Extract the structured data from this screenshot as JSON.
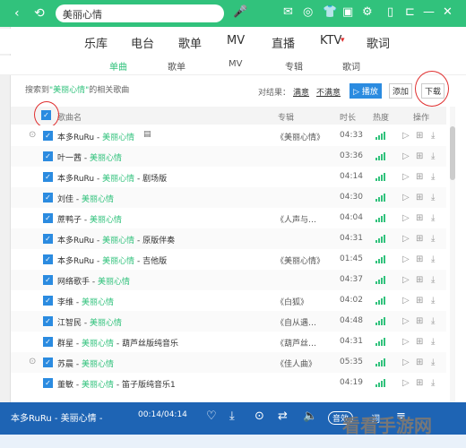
{
  "topbar": {
    "search_value": "美丽心情",
    "nav_back": "‹",
    "nav_refresh": "⟲"
  },
  "main_tabs": [
    "乐库",
    "电台",
    "歌单",
    "MV",
    "直播",
    "KTV",
    "歌词"
  ],
  "kt_badge": "▾",
  "sub_tabs": [
    "单曲",
    "歌单",
    "MV",
    "专辑",
    "歌词"
  ],
  "search_info": {
    "prefix": "搜索到",
    "keyword": "\"美丽心情\"",
    "suffix": "的相关歌曲"
  },
  "filter": {
    "label": "对结果：",
    "satisfied": "满意",
    "unsatisfied": "不满意"
  },
  "buttons": {
    "play": "▷ 播放",
    "add": "添加",
    "download": "下载"
  },
  "table_header": {
    "song": "歌曲名",
    "album": "专辑",
    "duration": "时长",
    "heat": "热度",
    "ops": "操作"
  },
  "rows": [
    {
      "artist": "本多RuRu",
      "sep": " - ",
      "title": "美丽心情",
      "extra": "",
      "album": "《美丽心情》",
      "duration": "04:33",
      "expand": true,
      "mv": true
    },
    {
      "artist": "叶一茜",
      "sep": " - ",
      "title": "美丽心情",
      "extra": "",
      "album": "",
      "duration": "03:36",
      "expand": false,
      "mv": false
    },
    {
      "artist": "本多RuRu",
      "sep": " - ",
      "title": "美丽心情",
      "extra": " - 剧场版",
      "album": "",
      "duration": "04:14",
      "expand": false,
      "mv": false
    },
    {
      "artist": "刘佳",
      "sep": " - ",
      "title": "美丽心情",
      "extra": "",
      "album": "",
      "duration": "04:30",
      "expand": false,
      "mv": false
    },
    {
      "artist": "蔗鸭子",
      "sep": " - ",
      "title": "美丽心情",
      "extra": "",
      "album": "《人声与…",
      "duration": "04:04",
      "expand": false,
      "mv": false
    },
    {
      "artist": "本多RuRu",
      "sep": " - ",
      "title": "美丽心情",
      "extra": " - 原版伴奏",
      "album": "",
      "duration": "04:31",
      "expand": false,
      "mv": false
    },
    {
      "artist": "本多RuRu",
      "sep": " - ",
      "title": "美丽心情",
      "extra": " - 吉他版",
      "album": "《美丽心情》",
      "duration": "01:45",
      "expand": false,
      "mv": false
    },
    {
      "artist": "网络歌手",
      "sep": " - ",
      "title": "美丽心情",
      "extra": "",
      "album": "",
      "duration": "04:37",
      "expand": false,
      "mv": false
    },
    {
      "artist": "李维",
      "sep": " - ",
      "title": "美丽心情",
      "extra": "",
      "album": "《白狐》",
      "duration": "04:02",
      "expand": false,
      "mv": false
    },
    {
      "artist": "江智民",
      "sep": " - ",
      "title": "美丽心情",
      "extra": "",
      "album": "《自从遇…",
      "duration": "04:48",
      "expand": false,
      "mv": false
    },
    {
      "artist": "群星",
      "sep": " - ",
      "title": "美丽心情",
      "extra": " - 葫芦丝版纯音乐",
      "album": "《葫芦丝…",
      "duration": "04:31",
      "expand": false,
      "mv": false
    },
    {
      "artist": "苏晨",
      "sep": " - ",
      "title": "美丽心情",
      "extra": "",
      "album": "《佳人曲》",
      "duration": "05:35",
      "expand": true,
      "mv": false
    },
    {
      "artist": "董敏",
      "sep": " - ",
      "title": "美丽心情",
      "extra": " - 笛子版纯音乐1",
      "album": "",
      "duration": "04:19",
      "expand": false,
      "mv": false
    }
  ],
  "player": {
    "now_playing": "本多RuRu - 美丽心情 -",
    "time": "00:14/04:14",
    "sound": "音效",
    "lyric": "词",
    "list": "≡"
  },
  "watermark": "看看手游网",
  "colors": {
    "accent": "#31c27c",
    "blue": "#2b8be0",
    "player_bg": "#1e64b4"
  }
}
